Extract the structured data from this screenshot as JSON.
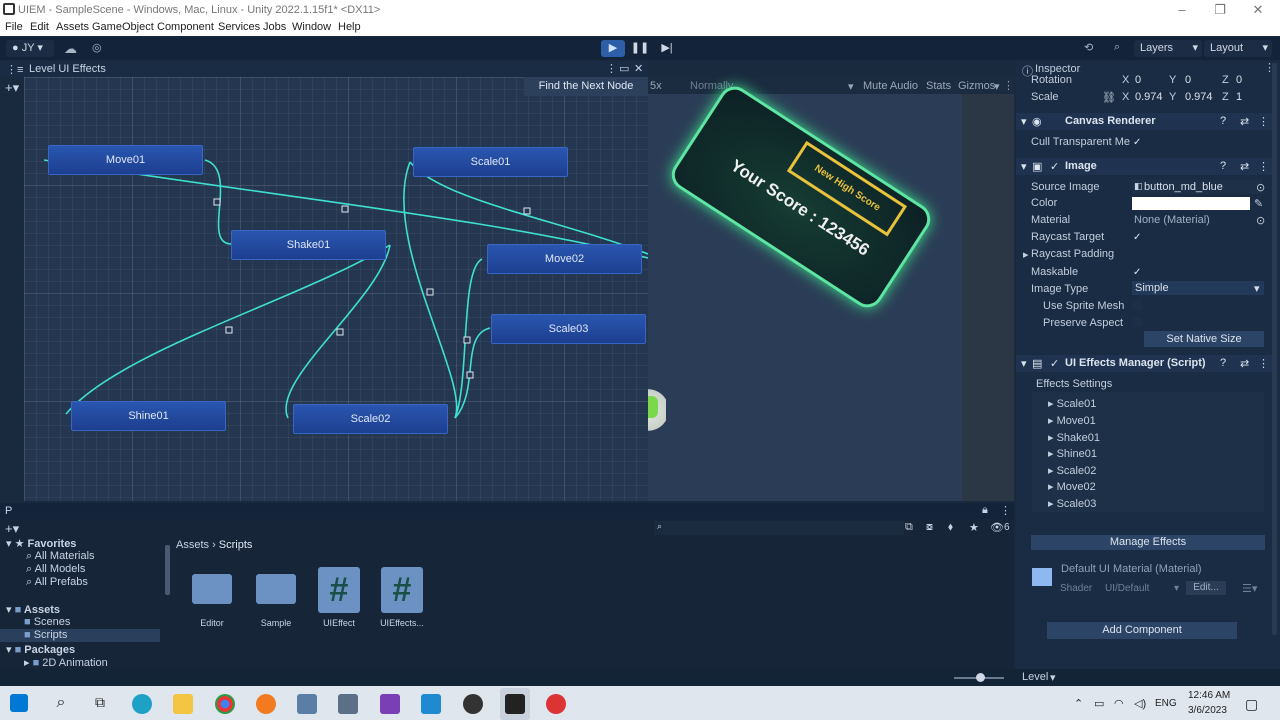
{
  "window": {
    "title": "UIEM - SampleScene - Windows, Mac, Linux - Unity 2022.1.15f1* <DX11>"
  },
  "menu": [
    "File",
    "Edit",
    "Assets",
    "GameObject",
    "Component",
    "Services",
    "Jobs",
    "Window",
    "Help"
  ],
  "toolbar": {
    "account": "JY",
    "layers": "Layers",
    "layout": "Layout"
  },
  "graph": {
    "tab": "Level UI Effects",
    "find_button": "Find the Next Node",
    "nodes": [
      "Move01",
      "Scale01",
      "Shake01",
      "Move02",
      "Scale03",
      "Shine01",
      "Scale02"
    ]
  },
  "game": {
    "scale_suffix": "5x",
    "normally": "Normally",
    "mute": "Mute Audio",
    "stats": "Stats",
    "gizmos": "Gizmos",
    "score_text": "Your Score : 123456",
    "badge_text": "New High Score"
  },
  "inspector": {
    "tab": "Inspector",
    "rotation": {
      "label": "Rotation",
      "x": "0",
      "y": "0",
      "z": "0"
    },
    "scale": {
      "label": "Scale",
      "x": "0.974",
      "y": "0.974",
      "z": "1"
    },
    "canvas_renderer": "Canvas Renderer",
    "cull": "Cull Transparent Me",
    "image": "Image",
    "source_image_label": "Source Image",
    "source_image": "button_md_blue",
    "color_label": "Color",
    "material_label": "Material",
    "material": "None (Material)",
    "raycast_target": "Raycast Target",
    "raycast_padding": "Raycast Padding",
    "maskable": "Maskable",
    "image_type_label": "Image Type",
    "image_type": "Simple",
    "use_sprite_mesh": "Use Sprite Mesh",
    "preserve_aspect": "Preserve Aspect",
    "set_native_size": "Set Native Size",
    "script": "UI Effects Manager (Script)",
    "effects_settings": "Effects Settings",
    "effects": [
      "Scale01",
      "Move01",
      "Shake01",
      "Shine01",
      "Scale02",
      "Move02",
      "Scale03"
    ],
    "manage_effects": "Manage Effects",
    "default_material": "Default UI Material (Material)",
    "shader_label": "Shader",
    "shader": "UI/Default",
    "edit": "Edit...",
    "add_component": "Add Component"
  },
  "project": {
    "tab": "P",
    "favorites": "Favorites",
    "fav_items": [
      "All Materials",
      "All Models",
      "All Prefabs"
    ],
    "assets": "Assets",
    "asset_items": [
      "Scenes",
      "Scripts"
    ],
    "packages": "Packages",
    "package_items": [
      "2D Animation"
    ],
    "breadcrumb": [
      "Assets",
      "Scripts"
    ],
    "files": [
      "Editor",
      "Sample",
      "UIEffect",
      "UIEffects..."
    ],
    "count": "6"
  },
  "status": {
    "level": "Level"
  },
  "taskbar": {
    "lang": "ENG",
    "time": "12:46 AM",
    "date": "3/6/2023"
  }
}
